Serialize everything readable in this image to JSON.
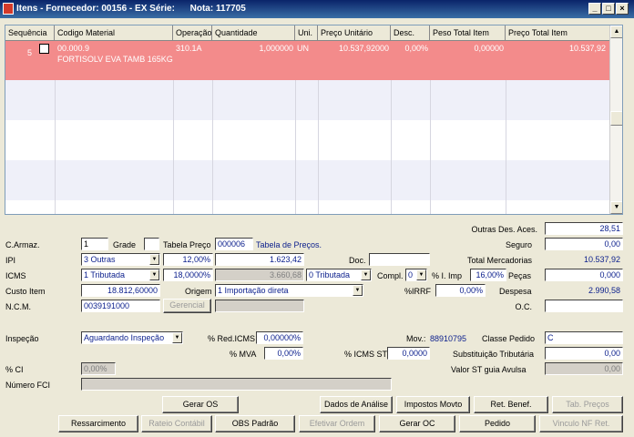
{
  "window": {
    "title": "Itens - Fornecedor: 00156 - EX Série:      Nota: 117705",
    "minimize": "_",
    "maximize": "□",
    "close": "×"
  },
  "grid": {
    "columns": [
      "Sequência",
      "Codigo Material",
      "Operação",
      "Quantidade",
      "Uni.",
      "Preço Unitário",
      "Desc.",
      "Peso Total Item",
      "Preço Total Item"
    ],
    "row": {
      "seq": "5",
      "codigo": "00.000.9",
      "descricao": "FORTISOLV EVA TAMB 165KG",
      "operacao": "310.1A",
      "quantidade": "1,000000",
      "uni": "UN",
      "preco_unitario": "10.537,92000",
      "desc": "0,00%",
      "peso_total": "0,00000",
      "preco_total": "10.537,92"
    }
  },
  "form": {
    "outras_des_aces": {
      "label": "Outras Des. Aces.",
      "value": "28,51"
    },
    "seguro": {
      "label": "Seguro",
      "value": "0,00"
    },
    "total_mercadorias": {
      "label": "Total Mercadorias",
      "value": "10.537,92"
    },
    "pecas": {
      "label": "Peças",
      "value": "0,000"
    },
    "despesa": {
      "label": "Despesa",
      "value": "2.990,58"
    },
    "oc": {
      "label": "O.C.",
      "value": ""
    },
    "c_armaz": {
      "label": "C.Armaz.",
      "value": "1"
    },
    "grade": {
      "label": "Grade",
      "value": ""
    },
    "tabela_preco": {
      "label": "Tabela Preço",
      "code": "000006",
      "name": "Tabela de Preços."
    },
    "ipi": {
      "label": "IPI",
      "select": "3 Outras",
      "pct": "12,00%",
      "value": "1.623,42"
    },
    "doc": {
      "label": "Doc.",
      "value": ""
    },
    "icms": {
      "label": "ICMS",
      "select": "1 Tributada",
      "pct": "18,0000%",
      "value": "3.660,68",
      "select2": "0 Tributada"
    },
    "compl": {
      "label": "Compl.",
      "value": "0"
    },
    "i_imp": {
      "label": "% I. Imp",
      "value": "16,00%"
    },
    "custo_item": {
      "label": "Custo Item",
      "value": "18.812,60000"
    },
    "origem": {
      "label": "Origem",
      "value": "1 Importação direta"
    },
    "irrf": {
      "label": "%IRRF",
      "value": "0,00%"
    },
    "ncm": {
      "label": "N.C.M.",
      "value": "0039191000",
      "gerencial": "Gerencial"
    },
    "inspecao": {
      "label": "Inspeção",
      "value": "Aguardando Inspeção"
    },
    "red_icms": {
      "label": "% Red.ICMS",
      "value": "0,00000%"
    },
    "mov": {
      "label": "Mov.:",
      "value": "88910795"
    },
    "classe_pedido": {
      "label": "Classe Pedido",
      "value": "C"
    },
    "mva": {
      "label": "% MVA",
      "value": "0,00%"
    },
    "icms_st": {
      "label": "% ICMS ST",
      "value": "0,0000"
    },
    "subst_trib": {
      "label": "Substituição Tributária",
      "value": "0,00"
    },
    "ci": {
      "label": "% CI",
      "value": "0,00%"
    },
    "valor_st": {
      "label": "Valor ST guia Avulsa",
      "value": "0,00"
    },
    "numero_fci": {
      "label": "Número FCI",
      "value": ""
    }
  },
  "buttons": {
    "gerar_os": "Gerar OS",
    "dados_analise": "Dados de Análise",
    "impostos_movto": "Impostos Movto",
    "ret_benef": "Ret. Benef.",
    "tab_precos": "Tab. Preços",
    "ressarcimento": "Ressarcimento",
    "rateio_contabil": "Rateio Contábil",
    "obs_padrao": "OBS Padrão",
    "efetivar_ordem": "Efetivar Ordem",
    "gerar_oc": "Gerar OC",
    "pedido": "Pedido",
    "vinculo_nf_ret": "Vinculo NF Ret."
  }
}
